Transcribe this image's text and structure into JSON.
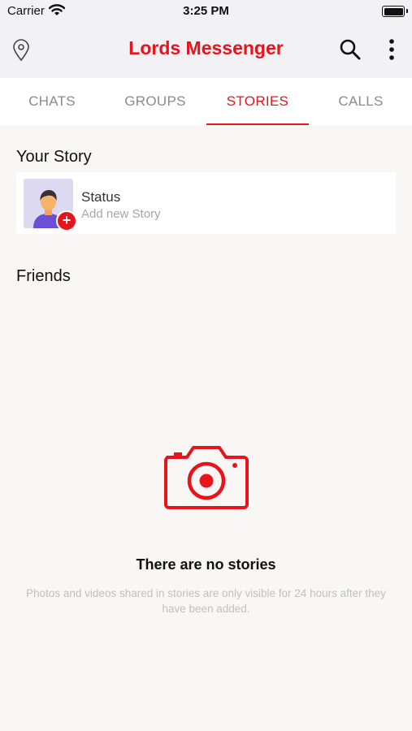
{
  "status_bar": {
    "carrier": "Carrier",
    "time": "3:25 PM"
  },
  "header": {
    "title": "Lords Messenger",
    "icons": [
      "location-pin-icon",
      "search-icon",
      "more-vertical-icon"
    ]
  },
  "tabs": [
    {
      "label": "CHATS",
      "active": false
    },
    {
      "label": "GROUPS",
      "active": false
    },
    {
      "label": "STORIES",
      "active": true
    },
    {
      "label": "CALLS",
      "active": false
    }
  ],
  "your_story": {
    "section_title": "Your Story",
    "name": "Status",
    "subtitle": "Add new Story",
    "badge": "+"
  },
  "friends": {
    "section_title": "Friends",
    "empty_icon": "camera-icon",
    "empty_title": "There are no stories",
    "empty_description": "Photos and videos shared in stories are only visible for 24 hours after they have been added."
  },
  "colors": {
    "accent": "#e8141b",
    "header_bg": "#f2f1f4",
    "page_bg": "#f8f7f6"
  }
}
